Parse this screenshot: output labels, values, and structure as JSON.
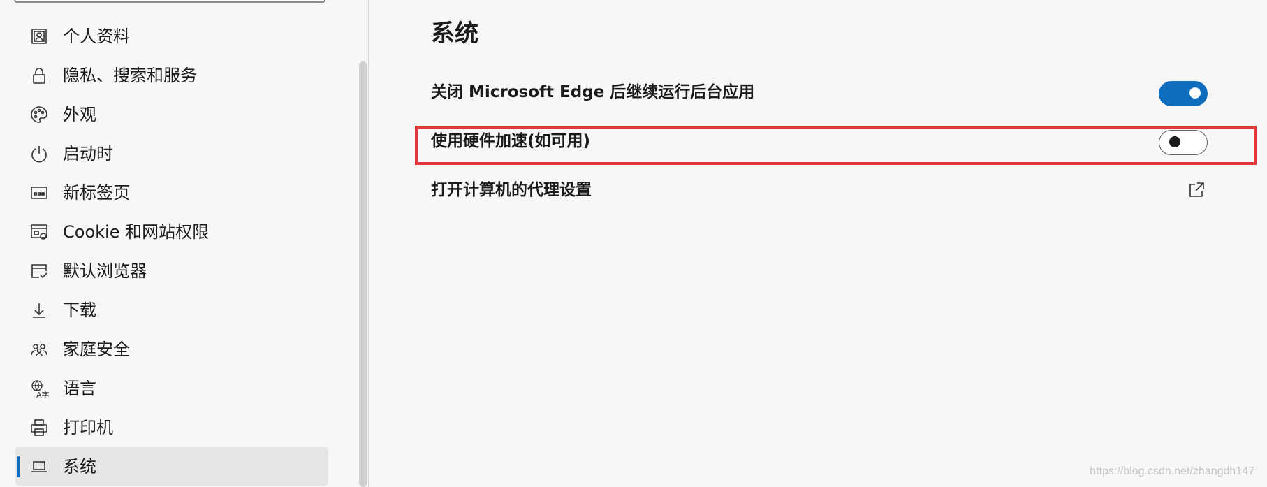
{
  "sidebar": {
    "items": [
      {
        "label": "个人资料",
        "icon": "profile-icon",
        "active": false
      },
      {
        "label": "隐私、搜索和服务",
        "icon": "lock-icon",
        "active": false
      },
      {
        "label": "外观",
        "icon": "palette-icon",
        "active": false
      },
      {
        "label": "启动时",
        "icon": "power-icon",
        "active": false
      },
      {
        "label": "新标签页",
        "icon": "new-tab-icon",
        "active": false
      },
      {
        "label": "Cookie 和网站权限",
        "icon": "site-permissions-icon",
        "active": false
      },
      {
        "label": "默认浏览器",
        "icon": "default-browser-icon",
        "active": false
      },
      {
        "label": "下载",
        "icon": "download-icon",
        "active": false
      },
      {
        "label": "家庭安全",
        "icon": "family-icon",
        "active": false
      },
      {
        "label": "语言",
        "icon": "language-icon",
        "active": false
      },
      {
        "label": "打印机",
        "icon": "printer-icon",
        "active": false
      },
      {
        "label": "系统",
        "icon": "laptop-icon",
        "active": true
      }
    ]
  },
  "main": {
    "title": "系统",
    "settings": [
      {
        "label": "关闭 Microsoft Edge 后继续运行后台应用",
        "control": "toggle",
        "state": "on"
      },
      {
        "label": "使用硬件加速(如可用)",
        "control": "toggle",
        "state": "off",
        "highlighted": true
      },
      {
        "label": "打开计算机的代理设置",
        "control": "external-link-icon"
      }
    ]
  },
  "watermark": "https://blog.csdn.net/zhangdh147",
  "colors": {
    "accent": "#0f6cbd",
    "highlight_box": "#e5383b",
    "background": "#f7f7f7"
  }
}
